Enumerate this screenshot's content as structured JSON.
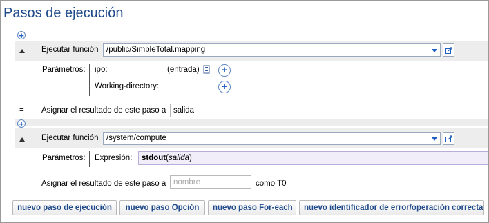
{
  "title": "Pasos de ejecución",
  "step1": {
    "action_label": "Ejecutar función",
    "function_path": "/public/SimpleTotal.mapping",
    "params_label": "Parámetros:",
    "params": [
      {
        "name": "ipo:",
        "kind": "(entrada)"
      },
      {
        "name": "Working-directory:",
        "kind": ""
      }
    ],
    "eq_symbol": "=",
    "assign_label": "Asignar el resultado de este paso a",
    "assign_value": "salida"
  },
  "step2": {
    "action_label": "Ejecutar función",
    "function_path": "/system/compute",
    "params_label": "Parámetros:",
    "expression_label": "Expresión:",
    "expression_func": "stdout",
    "expression_open": "(",
    "expression_arg": "salida",
    "expression_close": ")",
    "eq_symbol": "=",
    "assign_label": "Asignar el resultado de este paso a",
    "assign_placeholder": "nombre",
    "assign_suffix": "como T0"
  },
  "buttons": {
    "new_step": "nuevo paso de ejecución",
    "new_choice": "nuevo paso Opción",
    "new_foreach": "nuevo paso For-each",
    "new_error": "nuevo identificador de error/operación correcta"
  },
  "icons": {
    "add": "plus-icon",
    "dropdown": "chevron-down-icon",
    "open": "open-external-icon",
    "input_param": "input-parameter-icon",
    "collapse": "collapse-triangle-icon"
  }
}
